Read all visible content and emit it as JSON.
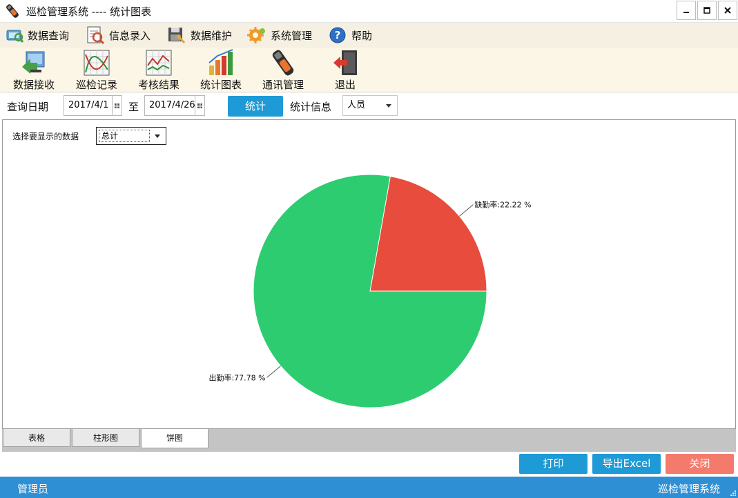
{
  "window": {
    "title": "巡检管理系统 ---- 统计图表",
    "controls": [
      "minimize",
      "maximize",
      "close"
    ]
  },
  "menu": [
    {
      "label": "数据查询",
      "icon": "data-query-icon"
    },
    {
      "label": "信息录入",
      "icon": "info-entry-icon"
    },
    {
      "label": "数据维护",
      "icon": "data-maintenance-icon"
    },
    {
      "label": "系统管理",
      "icon": "gear-icon"
    },
    {
      "label": "帮助",
      "icon": "help-icon"
    }
  ],
  "toolbar": [
    {
      "label": "数据接收",
      "icon": "data-receive-icon"
    },
    {
      "label": "巡检记录",
      "icon": "inspection-record-icon"
    },
    {
      "label": "考核结果",
      "icon": "assessment-result-icon"
    },
    {
      "label": "统计图表",
      "icon": "statistics-chart-icon"
    },
    {
      "label": "通讯管理",
      "icon": "communication-icon"
    },
    {
      "label": "退出",
      "icon": "exit-icon"
    }
  ],
  "query": {
    "date_label": "查询日期",
    "start_date": "2017/4/1",
    "to_label": "至",
    "end_date": "2017/4/26",
    "stat_button": "统计",
    "stat_info_label": "统计信息",
    "stat_info_value": "人员"
  },
  "panel": {
    "select_label": "选择要显示的数据",
    "select_value": "总计"
  },
  "chart_data": {
    "type": "pie",
    "slices": [
      {
        "label": "缺勤率:22.22 %",
        "value": 22.22,
        "color": "#e74c3c"
      },
      {
        "label": "出勤率:77.78 %",
        "value": 77.78,
        "color": "#2ecc71"
      }
    ],
    "start_angle_deg": 0,
    "direction": "counterclockwise",
    "legend": "none"
  },
  "tabs": [
    {
      "label": "表格",
      "active": false
    },
    {
      "label": "柱形图",
      "active": false
    },
    {
      "label": "饼图",
      "active": true
    }
  ],
  "actions": {
    "print": "打印",
    "export": "导出Excel",
    "close": "关闭"
  },
  "status": {
    "user": "管理员",
    "app": "巡检管理系统"
  }
}
